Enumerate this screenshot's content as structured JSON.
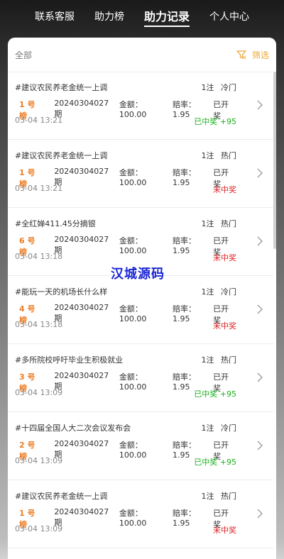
{
  "nav": {
    "tabs": [
      {
        "label": "联系客服"
      },
      {
        "label": "助力榜"
      },
      {
        "label": "助力记录"
      },
      {
        "label": "个人中心"
      }
    ]
  },
  "filter": {
    "all_label": "全部",
    "filter_label": "筛选"
  },
  "watermark": "汉城源码",
  "records": [
    {
      "title": "#建议农民养老金统一上调",
      "count": "1注",
      "heat": "冷门",
      "rank": "1 号榜",
      "period": "20240304027期",
      "amount": "金额：100.00",
      "odds": "赔率：1.95",
      "status": "已开奖",
      "time": "03-04 13:21",
      "result": "已中奖 +95",
      "win": true
    },
    {
      "title": "#建议农民养老金统一上调",
      "count": "1注",
      "heat": "热门",
      "rank": "1 号榜",
      "period": "20240304027期",
      "amount": "金额：100.00",
      "odds": "赔率：1.95",
      "status": "已开奖",
      "time": "03-04 13:21",
      "result": "未中奖",
      "win": false
    },
    {
      "title": "#全红婵411.45分摘银",
      "count": "1注",
      "heat": "热门",
      "rank": "6 号榜",
      "period": "20240304027期",
      "amount": "金额：100.00",
      "odds": "赔率：1.95",
      "status": "已开奖",
      "time": "03-04 13:18",
      "result": "未中奖",
      "win": false
    },
    {
      "title": "#能玩一天的机场长什么样",
      "count": "1注",
      "heat": "冷门",
      "rank": "4 号榜",
      "period": "20240304027期",
      "amount": "金额：100.00",
      "odds": "赔率：1.95",
      "status": "已开奖",
      "time": "03-04 13:18",
      "result": "未中奖",
      "win": false
    },
    {
      "title": "#多所院校呼吁毕业生积极就业",
      "count": "1注",
      "heat": "热门",
      "rank": "3 号榜",
      "period": "20240304027期",
      "amount": "金额：100.00",
      "odds": "赔率：1.95",
      "status": "已开奖",
      "time": "03-04 13:09",
      "result": "已中奖 +95",
      "win": true
    },
    {
      "title": "#十四届全国人大二次会议发布会",
      "count": "1注",
      "heat": "冷门",
      "rank": "2 号榜",
      "period": "20240304027期",
      "amount": "金额：100.00",
      "odds": "赔率：1.95",
      "status": "已开奖",
      "time": "03-04 13:09",
      "result": "已中奖 +95",
      "win": true
    },
    {
      "title": "#建议农民养老金统一上调",
      "count": "1注",
      "heat": "热门",
      "rank": "1 号榜",
      "period": "20240304027期",
      "amount": "金额：100.00",
      "odds": "赔率：1.95",
      "status": "已开奖",
      "time": "03-04 13:09",
      "result": "未中奖",
      "win": false
    }
  ],
  "colors": {
    "win": "#17b11a",
    "lose": "#e02020",
    "rank": "#ee7d23",
    "accent": "#e8a838"
  }
}
